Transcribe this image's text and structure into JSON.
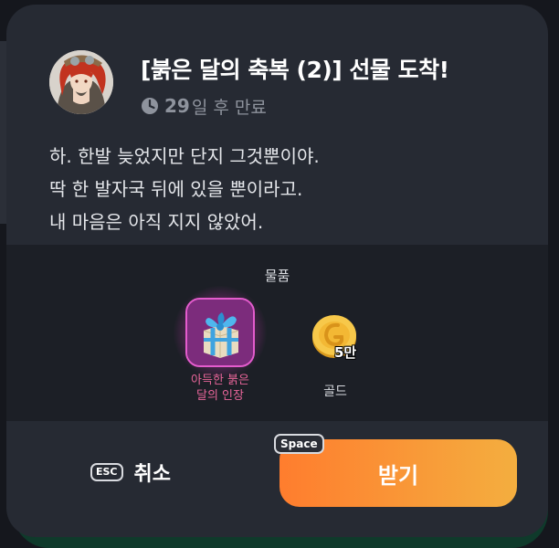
{
  "gift": {
    "title": "[붉은 달의 축복 (2)] 선물 도착!",
    "expiry_days": "29",
    "expiry_text": "일 후 만료",
    "message_lines": [
      "하. 한발 늦었지만 단지 그것뿐이야.",
      "딱 한 발자국 뒤에 있을 뿐이라고.",
      "내 마음은 아직 지지 않았어."
    ]
  },
  "items": {
    "label": "물품",
    "list": [
      {
        "name_line1": "아득한 붉은",
        "name_line2": "달의 인장",
        "icon": "gift-box-icon"
      },
      {
        "name": "골드",
        "quantity": "5만",
        "icon": "gold-coin-icon"
      }
    ]
  },
  "actions": {
    "cancel_key": "ESC",
    "cancel_label": "취소",
    "accept_key": "Space",
    "accept_label": "받기"
  },
  "colors": {
    "accent_start": "#ff7d2e",
    "accent_end": "#f4ae3f",
    "rare_item": "#e8659a",
    "panel": "#262a33"
  }
}
